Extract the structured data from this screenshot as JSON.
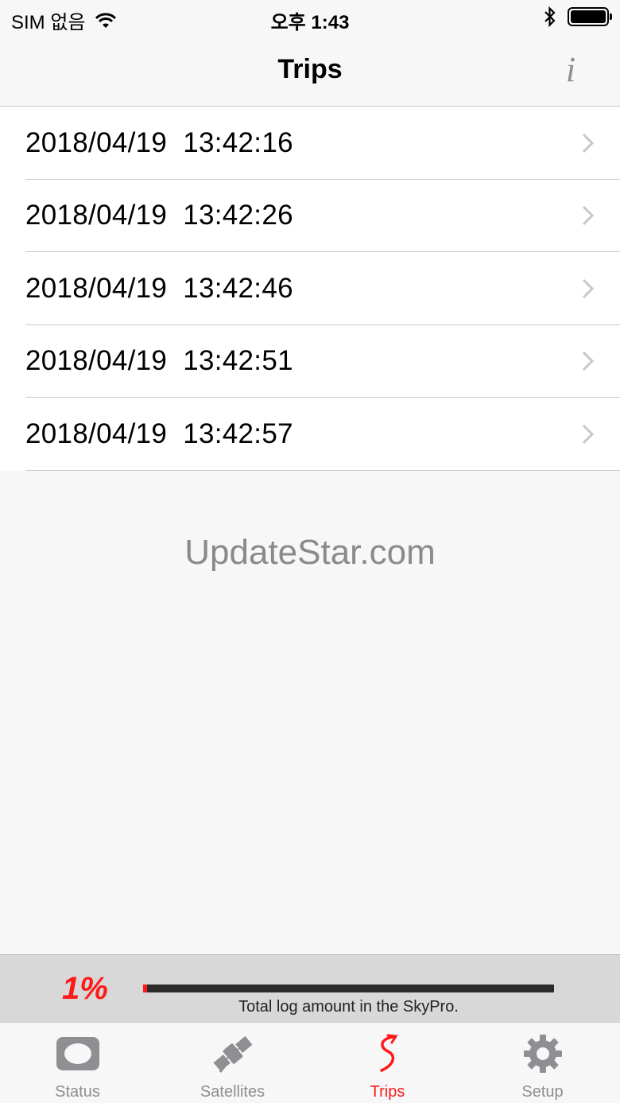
{
  "status_bar": {
    "carrier": "SIM 없음",
    "time": "오후 1:43"
  },
  "nav": {
    "title": "Trips",
    "info_label": "i"
  },
  "trips": [
    {
      "label": "2018/04/19  13:42:16"
    },
    {
      "label": "2018/04/19  13:42:26"
    },
    {
      "label": "2018/04/19  13:42:46"
    },
    {
      "label": "2018/04/19  13:42:51"
    },
    {
      "label": "2018/04/19  13:42:57"
    }
  ],
  "watermark": "UpdateStar.com",
  "log": {
    "percent_label": "1%",
    "percent_value": 0.01,
    "caption": "Total log amount in the SkyPro."
  },
  "tabs": [
    {
      "label": "Status",
      "icon": "status-icon",
      "active": false
    },
    {
      "label": "Satellites",
      "icon": "satellite-icon",
      "active": false
    },
    {
      "label": "Trips",
      "icon": "trips-icon",
      "active": true
    },
    {
      "label": "Setup",
      "icon": "gear-icon",
      "active": false
    }
  ],
  "colors": {
    "accent": "#ff1a1a",
    "inactive": "#8e8e93",
    "background": "#f7f7f7"
  }
}
